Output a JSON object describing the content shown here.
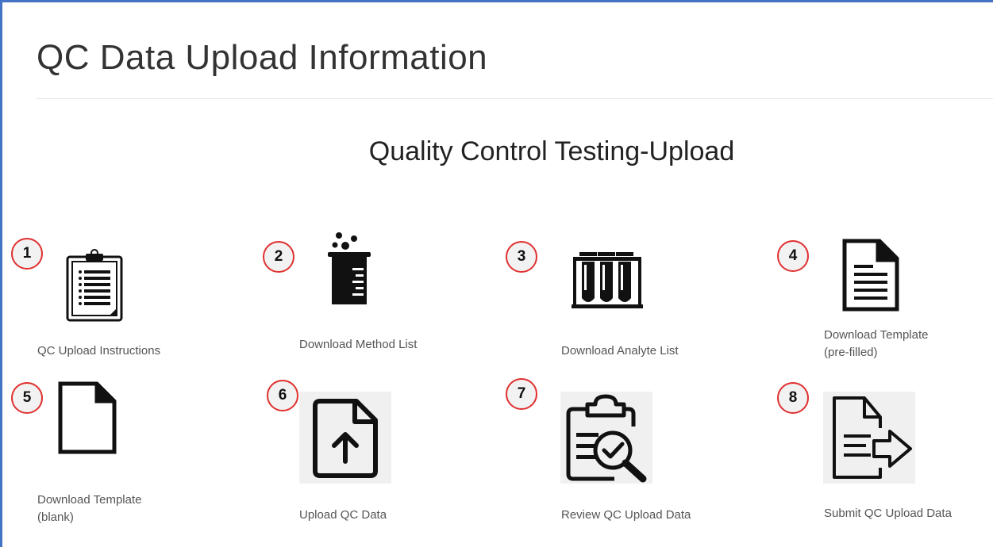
{
  "page": {
    "title": "QC Data Upload Information",
    "section_title": "Quality Control Testing-Upload"
  },
  "steps": [
    {
      "number": "1",
      "label": "QC Upload Instructions",
      "icon": "clipboard-list-icon"
    },
    {
      "number": "2",
      "label": "Download Method List",
      "icon": "beaker-icon"
    },
    {
      "number": "3",
      "label": "Download Analyte List",
      "icon": "test-tubes-icon"
    },
    {
      "number": "4",
      "label_line1": "Download Template",
      "label_line2": "(pre-filled)",
      "icon": "filled-document-icon"
    },
    {
      "number": "5",
      "label_line1": "Download Template",
      "label_line2": "(blank)",
      "icon": "blank-document-icon"
    },
    {
      "number": "6",
      "label": "Upload QC Data",
      "icon": "file-upload-icon"
    },
    {
      "number": "7",
      "label": "Review QC Upload Data",
      "icon": "clipboard-review-icon"
    },
    {
      "number": "8",
      "label": "Submit QC Upload Data",
      "icon": "document-submit-icon"
    }
  ],
  "colors": {
    "badge_border": "#e03030",
    "badge_fill": "#f2f2f2",
    "frame_border": "#4472c4",
    "icon_tile": "#f0f0f0"
  }
}
